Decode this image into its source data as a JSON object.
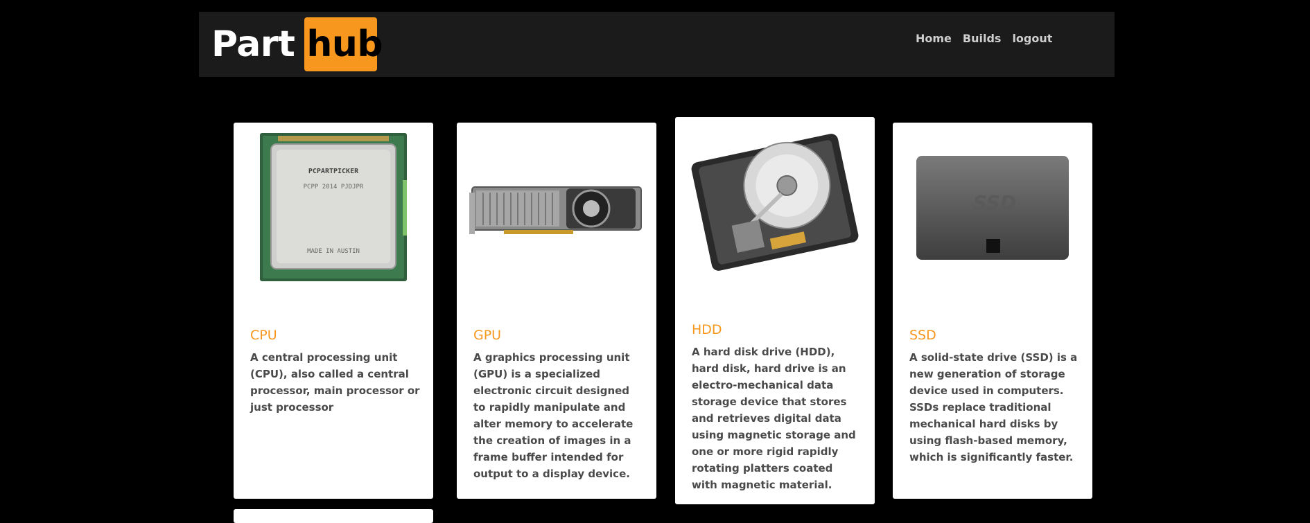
{
  "brand": {
    "part": "Part",
    "hub": "hub"
  },
  "nav": {
    "home": "Home",
    "builds": "Builds",
    "logout": "logout"
  },
  "cards": [
    {
      "title": "CPU",
      "description": "A central processing unit (CPU), also called a central processor, main processor or just processor",
      "chip_brand": "PCPARTPICKER",
      "chip_model": "PCPP 2014 PJDJPR",
      "chip_origin": "MADE IN AUSTIN"
    },
    {
      "title": "GPU",
      "description": "A graphics processing unit (GPU) is a specialized electronic circuit designed to rapidly manipulate and alter memory to accelerate the creation of images in a frame buffer intended for output to a display device."
    },
    {
      "title": "HDD",
      "description": "A hard disk drive (HDD), hard disk, hard drive is an electro-mechanical data storage device that stores and retrieves digital data using magnetic storage and one or more rigid rapidly rotating platters coated with magnetic material."
    },
    {
      "title": "SSD",
      "description": "A solid-state drive (SSD) is a new generation of storage device used in computers. SSDs replace traditional mechanical hard disks by using flash-based memory, which is significantly faster.",
      "drive_label": "SSD"
    }
  ],
  "colors": {
    "accent": "#f7971d",
    "header_bg": "#1b1b1b",
    "page_bg": "#000000"
  }
}
